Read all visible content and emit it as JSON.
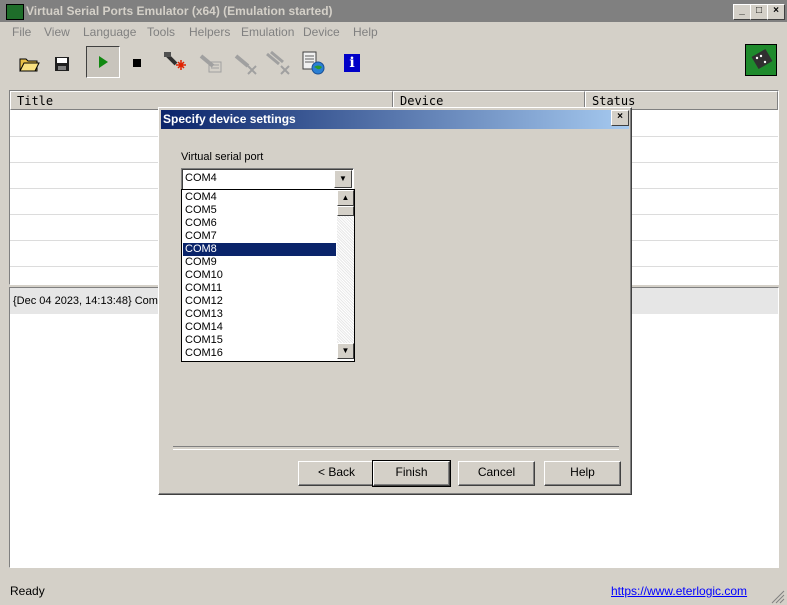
{
  "window": {
    "title": "Virtual Serial Ports Emulator (x64) (Emulation started)",
    "min": "_",
    "max": "□",
    "close": "×"
  },
  "menu": [
    "File",
    "View",
    "Language",
    "Tools",
    "Helpers",
    "Emulation",
    "Device",
    "Help"
  ],
  "toolbar": {
    "icons": [
      "open-folder-icon",
      "save-icon",
      "play-icon",
      "stop-icon",
      "add-device-icon",
      "edit-device-icon",
      "delete-device-icon",
      "delete-all-icon",
      "network-settings-icon",
      "info-icon",
      "app-logo-icon"
    ],
    "info_glyph": "i"
  },
  "grid": {
    "columns": [
      "Title",
      "Device",
      "Status"
    ],
    "row_count": 7
  },
  "log": {
    "first_line": "{Dec 04 2023, 14:13:48} Comm"
  },
  "statusbar": {
    "text": "Ready",
    "link": "https://www.eterlogic.com"
  },
  "dialog": {
    "title": "Specify device settings",
    "close": "×",
    "port_label": "Virtual serial port",
    "port_value": "COM4",
    "options": [
      "COM4",
      "COM5",
      "COM6",
      "COM7",
      "COM8",
      "COM9",
      "COM10",
      "COM11",
      "COM12",
      "COM13",
      "COM14",
      "COM15",
      "COM16"
    ],
    "selected": "COM8",
    "buttons": {
      "back": "< Back",
      "finish": "Finish",
      "cancel": "Cancel",
      "help": "Help"
    }
  },
  "colors": {
    "selection": "#0a246a",
    "link": "#0000ff",
    "titlebar_inactive": "#808080"
  }
}
